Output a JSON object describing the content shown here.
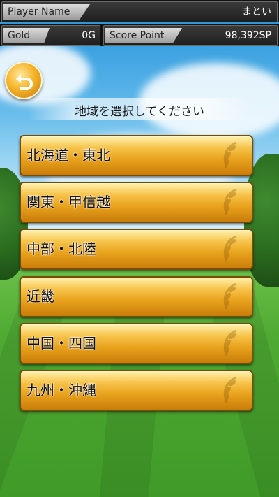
{
  "hud": {
    "player_name_label": "Player Name",
    "player_name": "まとい",
    "gold_label": "Gold",
    "gold_value": "0G",
    "score_label": "Score Point",
    "score_value": "98,392SP"
  },
  "prompt": "地域を選択してください",
  "regions": [
    {
      "label": "北海道・東北"
    },
    {
      "label": "関東・甲信越"
    },
    {
      "label": "中部・北陸"
    },
    {
      "label": "近畿"
    },
    {
      "label": "中国・四国"
    },
    {
      "label": "九州・沖縄"
    }
  ],
  "icons": {
    "back": "back-arrow-icon",
    "laurel": "laurel-icon"
  },
  "colors": {
    "button_gold": "#f0b030",
    "button_border": "#7a4a07",
    "hud_bg": "#111111"
  }
}
